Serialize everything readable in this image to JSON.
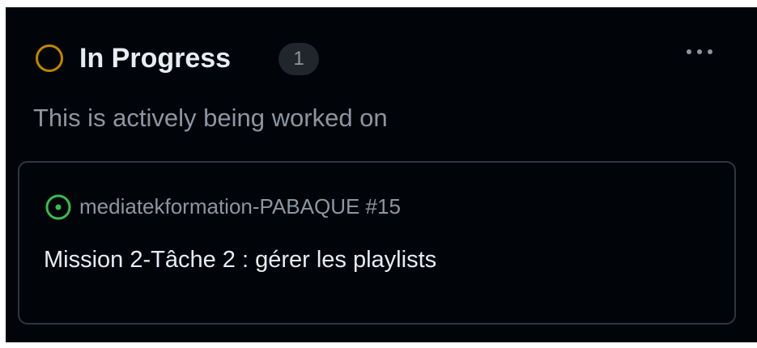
{
  "column": {
    "title": "In Progress",
    "count": "1",
    "description": "This is actively being worked on",
    "status_icon": "circle-outline-icon",
    "menu_icon": "kebab-horizontal-icon",
    "status_color": "#bf8700"
  },
  "card": {
    "repo_ref": "mediatekformation-PABAQUE #15",
    "title": "Mission 2-Tâche 2 : gérer les playlists",
    "issue_state_icon": "issue-opened-icon",
    "issue_state_color": "#3fb950"
  },
  "colors": {
    "background": "#010409",
    "text_primary": "#e6edf3",
    "text_muted": "#8d96a0",
    "border": "#30363d",
    "badge_background": "#21262d"
  }
}
